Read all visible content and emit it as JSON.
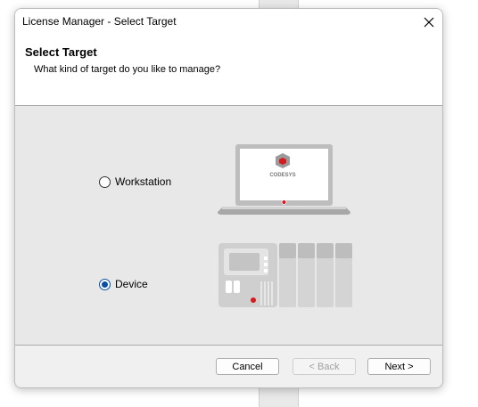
{
  "window": {
    "title": "License Manager - Select Target",
    "close_glyph": "✕"
  },
  "header": {
    "title": "Select Target",
    "subtitle": "What kind of target do you like to manage?"
  },
  "options": {
    "workstation": {
      "label": "Workstation",
      "selected": false
    },
    "device": {
      "label": "Device",
      "selected": true
    }
  },
  "illustration": {
    "laptop_logo_text": "CODESYS"
  },
  "footer": {
    "cancel_label": "Cancel",
    "back_label": "< Back",
    "next_label": "Next >"
  },
  "colors": {
    "accent": "#0a4fa3",
    "codesys_red": "#d71920"
  }
}
